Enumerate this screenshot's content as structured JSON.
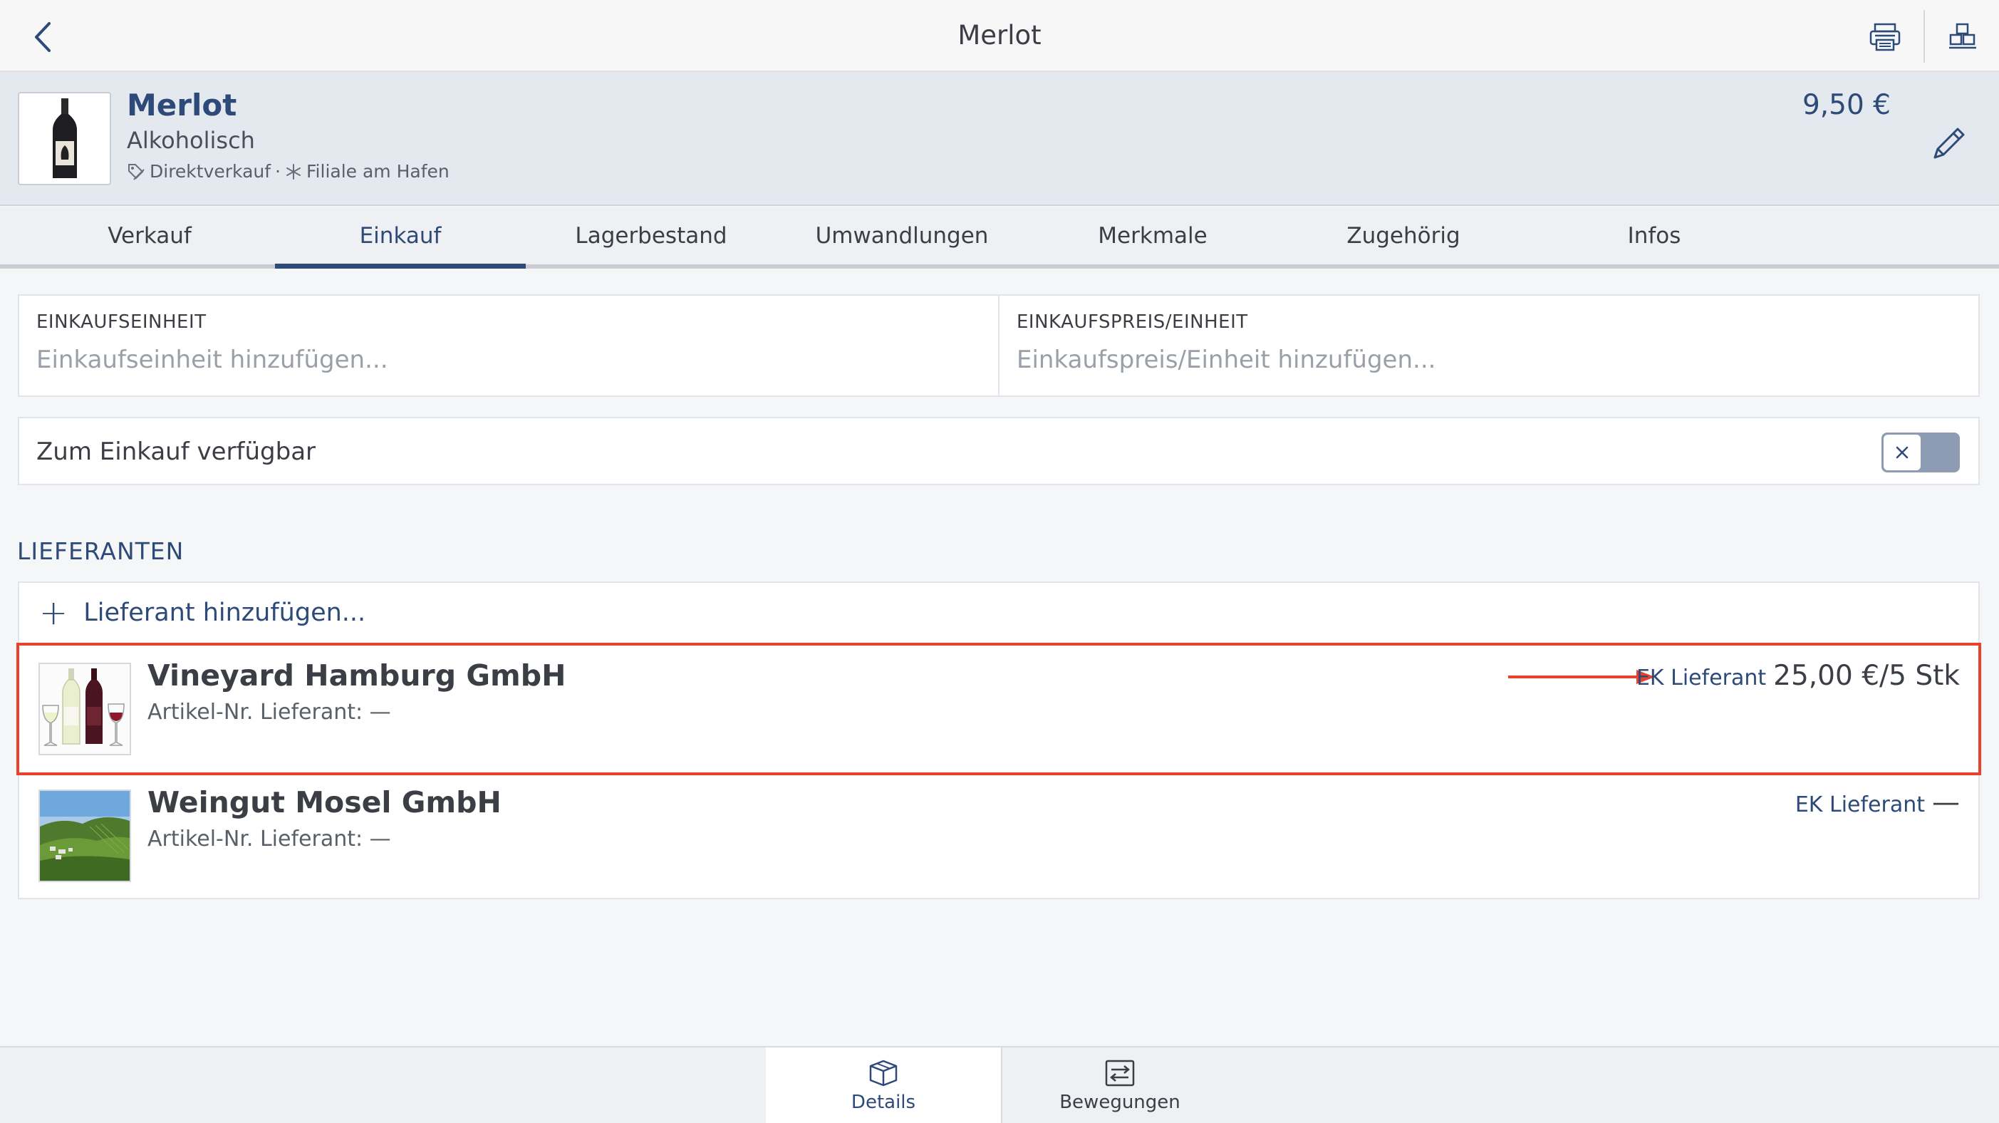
{
  "nav": {
    "title": "Merlot",
    "back_icon": "chevron-left-icon",
    "print_icon": "printer-icon",
    "stock_icon": "boxes-icon"
  },
  "product": {
    "name": "Merlot",
    "category": "Alkoholisch",
    "sale_type": "Direktverkauf",
    "separator": "·",
    "location": "Filiale am Hafen",
    "price": "9,50 €",
    "image_icon": "wine-bottle-icon",
    "edit_icon": "pencil-icon"
  },
  "tabs": [
    {
      "label": "Verkauf",
      "active": false
    },
    {
      "label": "Einkauf",
      "active": true
    },
    {
      "label": "Lagerbestand",
      "active": false
    },
    {
      "label": "Umwandlungen",
      "active": false
    },
    {
      "label": "Merkmale",
      "active": false
    },
    {
      "label": "Zugehörig",
      "active": false
    },
    {
      "label": "Infos",
      "active": false
    }
  ],
  "purchase": {
    "unit_label": "EINKAUFSEINHEIT",
    "unit_value": "",
    "unit_placeholder": "Einkaufseinheit hinzufügen...",
    "price_label": "EINKAUFSPREIS/EINHEIT",
    "price_value": "",
    "price_placeholder": "Einkaufspreis/Einheit hinzufügen...",
    "available_label": "Zum Einkauf verfügbar",
    "available": false
  },
  "suppliers": {
    "section_title": "LIEFERANTEN",
    "add_label": "Lieferant hinzufügen...",
    "items": [
      {
        "name": "Vineyard Hamburg GmbH",
        "article_no": "Artikel-Nr. Lieferant: —",
        "price_label": "EK Lieferant",
        "price_value": "25,00 €/5 Stk",
        "highlighted": true
      },
      {
        "name": "Weingut Mosel GmbH",
        "article_no": "Artikel-Nr. Lieferant: —",
        "price_label": "EK Lieferant",
        "price_value": "—",
        "highlighted": false
      }
    ]
  },
  "bottom_tabs": [
    {
      "label": "Details",
      "icon": "box-icon",
      "active": true
    },
    {
      "label": "Bewegungen",
      "icon": "transfer-icon",
      "active": false
    }
  ],
  "colors": {
    "accent": "#2d4a78",
    "highlight": "#e8412c",
    "header_bg": "#e4e8ef",
    "toggle_off": "#8e9cb3"
  }
}
